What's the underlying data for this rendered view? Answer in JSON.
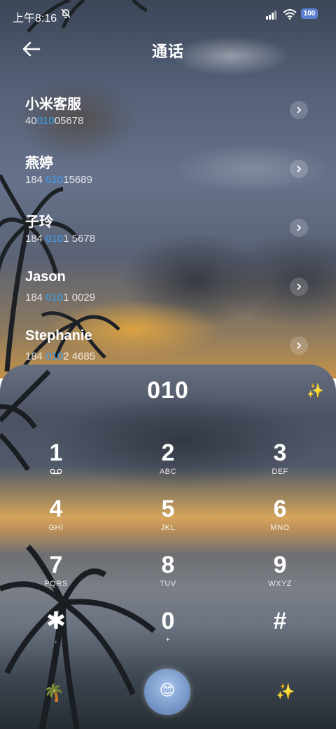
{
  "status_bar": {
    "time": "上午8:16",
    "mute_icon": "mute-bell-icon",
    "battery": "100",
    "battery_color": "#5d7fd1"
  },
  "header": {
    "title": "通话",
    "back_icon": "back-arrow-icon"
  },
  "contacts": [
    {
      "name": "小米客服",
      "num_pre": "40",
      "num_hl": "010",
      "num_post": "05678"
    },
    {
      "name": "燕婷",
      "num_pre": "184 ",
      "num_hl": "010",
      "num_post": "15689"
    },
    {
      "name": "子玲",
      "num_pre": "184 ",
      "num_hl": "010",
      "num_post": "1 5678"
    },
    {
      "name": "Jason",
      "num_pre": "184 ",
      "num_hl": "010",
      "num_post": "1 0029"
    },
    {
      "name": "Stephanie",
      "num_pre": "184 ",
      "num_hl": "010",
      "num_post": "2 4685"
    }
  ],
  "highlight_color": "#3aa0f0",
  "dialer": {
    "entered": "010",
    "top_right_icon": "sparkle-icon",
    "keys": [
      {
        "digit": "1",
        "sub": "",
        "icon": "voicemail-icon"
      },
      {
        "digit": "2",
        "sub": "ABC"
      },
      {
        "digit": "3",
        "sub": "DEF"
      },
      {
        "digit": "4",
        "sub": "GHI"
      },
      {
        "digit": "5",
        "sub": "JKL"
      },
      {
        "digit": "6",
        "sub": "MNO"
      },
      {
        "digit": "7",
        "sub": "PQRS"
      },
      {
        "digit": "8",
        "sub": "TUV"
      },
      {
        "digit": "9",
        "sub": "WXYZ"
      },
      {
        "digit": "✱",
        "sub": ","
      },
      {
        "digit": "0",
        "sub": "+"
      },
      {
        "digit": "#",
        "sub": ""
      }
    ],
    "bottom_left_icon": "🌴",
    "call_icon": "😊",
    "bottom_right_icon": "✨"
  }
}
